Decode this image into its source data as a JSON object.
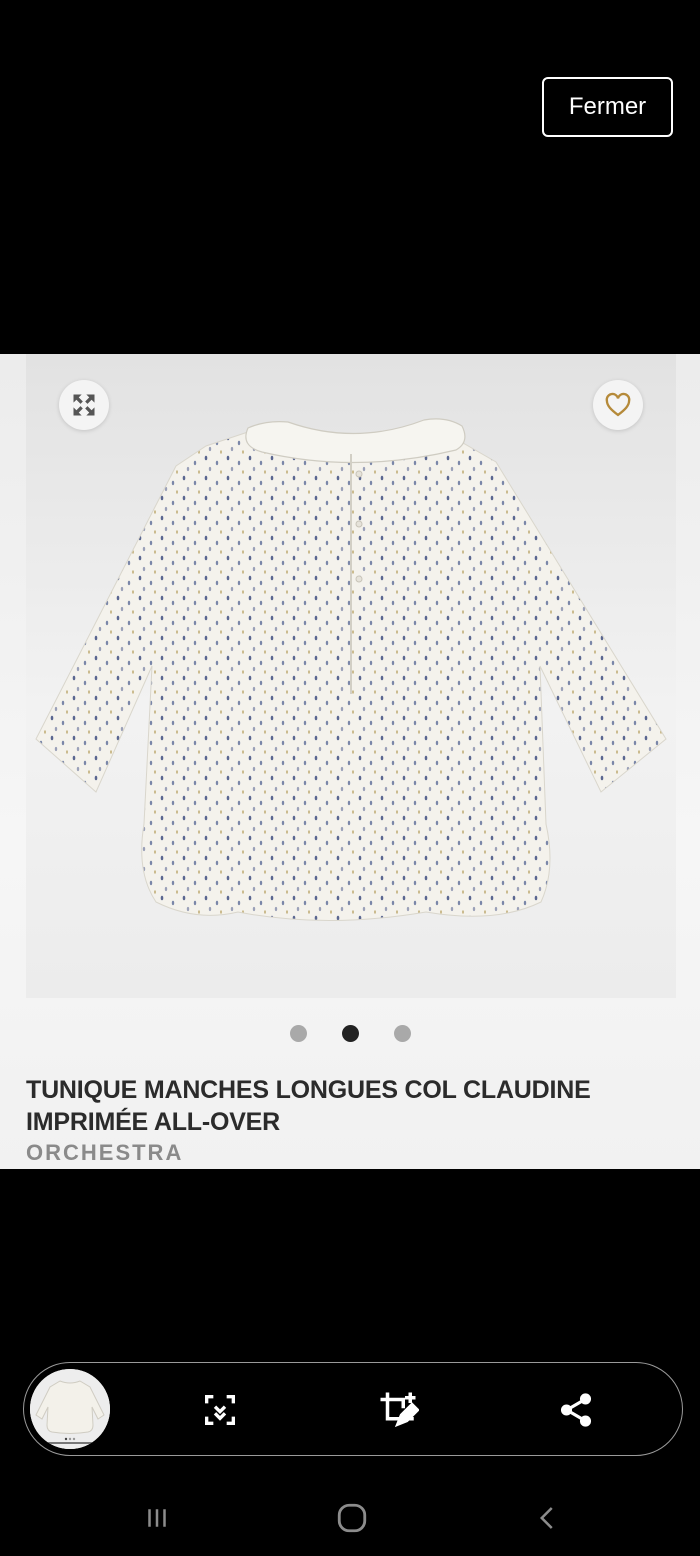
{
  "header": {
    "close_label": "Fermer"
  },
  "product": {
    "title": "TUNIQUE MANCHES LONGUES COL CLAUDINE IMPRIMÉE ALL-OVER",
    "brand": "ORCHESTRA",
    "carousel": {
      "total": 3,
      "active_index": 1
    }
  },
  "icons": {
    "expand": "expand-arrows-icon",
    "favorite": "heart-outline-icon",
    "scan": "scan-text-icon",
    "crop": "crop-edit-icon",
    "share": "share-icon",
    "recents": "recents-icon",
    "home": "home-icon",
    "back": "back-icon"
  },
  "colors": {
    "accent_heart": "#b58a3a",
    "background": "#000000"
  }
}
